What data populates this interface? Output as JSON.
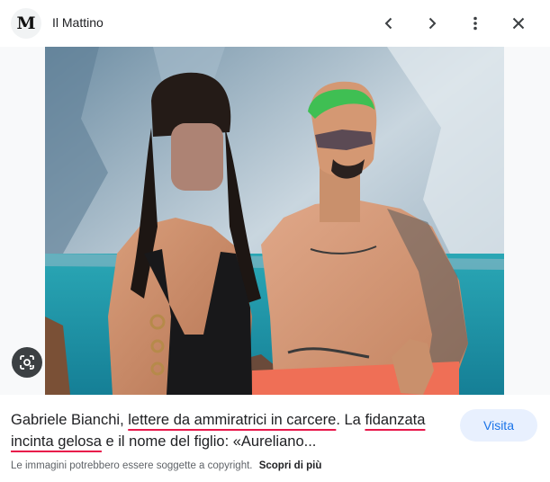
{
  "header": {
    "logo_letter": "M",
    "source_name": "Il Mattino",
    "icons": [
      "chevron-left-icon",
      "chevron-right-icon",
      "more-vert-icon",
      "close-icon"
    ]
  },
  "image": {
    "description_icon": "google-lens-icon"
  },
  "caption": {
    "part1": "Gabriele Bianchi, ",
    "link1": "lettere da ammiratrici in carcere",
    "part2": ". La ",
    "link2": "fidanzata incinta gelosa",
    "part3": " e il nome del figlio: «Aureliano..."
  },
  "visit_button": {
    "label": "Visita"
  },
  "footer": {
    "copyright_text": "Le immagini potrebbero essere soggette a copyright.",
    "learn_more": "Scopri di più"
  },
  "colors": {
    "accent": "#1a73e8",
    "underline": "#e8174a",
    "button_bg": "#e8f0fe"
  }
}
